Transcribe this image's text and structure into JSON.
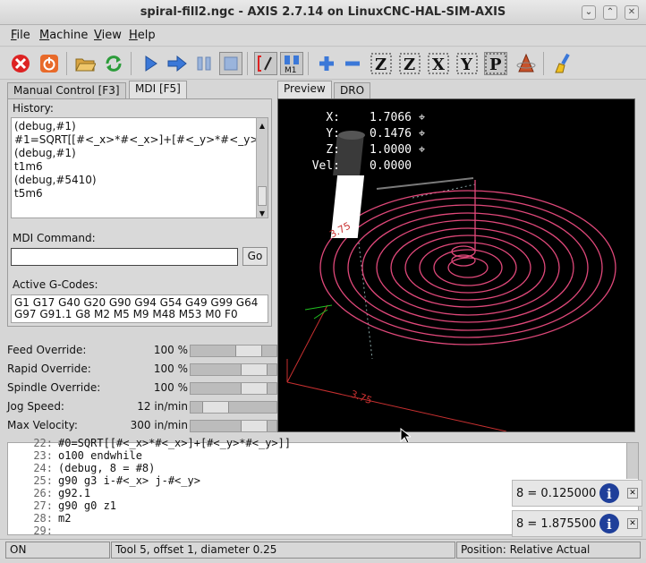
{
  "window": {
    "title": "spiral-fill2.ngc - AXIS 2.7.14 on LinuxCNC-HAL-SIM-AXIS",
    "controls": [
      "chevron-down",
      "chevron-up",
      "close"
    ]
  },
  "menu": [
    {
      "label": "File"
    },
    {
      "label": "Machine"
    },
    {
      "label": "View"
    },
    {
      "label": "Help"
    }
  ],
  "toolbar": {
    "icons": [
      "estop-icon",
      "power-icon",
      "open-file-icon",
      "reload-icon",
      "run-icon",
      "step-icon",
      "pause-icon",
      "stop-icon",
      "block-delete-icon",
      "optional-stop-icon",
      "zoom-in-icon",
      "zoom-out-icon",
      "view-z-icon",
      "view-z2-icon",
      "view-x-icon",
      "view-y-icon",
      "view-p-icon",
      "rotate-view-icon",
      "clear-plot-icon"
    ],
    "optional_stop_text": "M1",
    "view_labels": [
      "Z",
      "Z",
      "X",
      "Y",
      "P"
    ]
  },
  "left_tabs": {
    "manual": "Manual Control [F3]",
    "mdi": "MDI [F5]"
  },
  "mdi": {
    "history_label": "History:",
    "history": [
      "(debug,#1)",
      "#1=SQRT[[#<_x>*#<_x>]+[#<_y>*#<_y>",
      "(debug,#1)",
      "t1m6",
      "(debug,#5410)",
      "t5m6"
    ],
    "command_label": "MDI Command:",
    "command_value": "",
    "go_label": "Go",
    "gcodes_label": "Active G-Codes:",
    "gcodes_line1": "G1 G17 G40 G20 G90 G94 G54 G49 G99 G64",
    "gcodes_line2": "G97 G91.1 G8 M2 M5 M9 M48 M53 M0 F0"
  },
  "overrides": [
    {
      "name": "Feed Override:",
      "value": "100 %",
      "level": 0.75
    },
    {
      "name": "Rapid Override:",
      "value": "100 %",
      "level": 0.85
    },
    {
      "name": "Spindle Override:",
      "value": "100 %",
      "level": 0.85
    },
    {
      "name": "Jog Speed:",
      "value": "12 in/min",
      "level": 0.2
    },
    {
      "name": "Max Velocity:",
      "value": "300 in/min",
      "level": 0.85
    }
  ],
  "right_tabs": {
    "preview": "Preview",
    "dro": "DRO"
  },
  "dro": [
    {
      "axis": "X:",
      "value": "1.7066"
    },
    {
      "axis": "Y:",
      "value": "0.1476"
    },
    {
      "axis": "Z:",
      "value": "1.0000"
    },
    {
      "axis": "Vel:",
      "value": "0.0000"
    }
  ],
  "preview": {
    "dimension_label": "3.75",
    "dimension_label_2": "3.75",
    "colors": {
      "path": "#e0487a",
      "grid": "#c83030",
      "tool": "#ffffff"
    }
  },
  "code": [
    {
      "ln": "22:",
      "text": "#0=SQRT[[#<_x>*#<_x>]+[#<_y>*#<_y>]]"
    },
    {
      "ln": "23:",
      "text": "o100 endwhile"
    },
    {
      "ln": "24:",
      "text": "(debug, 8 = #8)"
    },
    {
      "ln": "25:",
      "text": "g90 g3 i-#<_x> j-#<_y>"
    },
    {
      "ln": "26:",
      "text": "g92.1"
    },
    {
      "ln": "27:",
      "text": "g90 g0 z1"
    },
    {
      "ln": "28:",
      "text": "m2"
    },
    {
      "ln": "29:",
      "text": ""
    }
  ],
  "notifications": [
    {
      "text": "8 = 0.125000"
    },
    {
      "text": "8 = 1.875500"
    }
  ],
  "status": {
    "state": "ON",
    "tool": "Tool 5, offset 1, diameter 0.25",
    "position": "Position: Relative Actual"
  }
}
